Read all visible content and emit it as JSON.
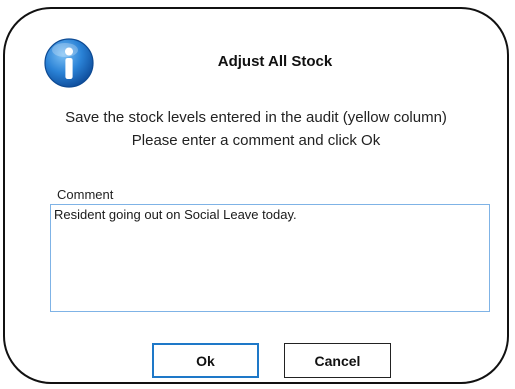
{
  "dialog": {
    "title": "Adjust All Stock",
    "icon": "info-icon",
    "message_line1": "Save the stock levels entered in the audit (yellow column)",
    "message_line2": "Please enter a comment and click Ok"
  },
  "comment": {
    "label": "Comment",
    "value": "Resident going out on Social Leave today."
  },
  "buttons": {
    "ok_label": "Ok",
    "cancel_label": "Cancel"
  },
  "colors": {
    "accent": "#1e78c8",
    "input_border": "#7fb3e6",
    "icon_blue": "#1a6fc4"
  }
}
